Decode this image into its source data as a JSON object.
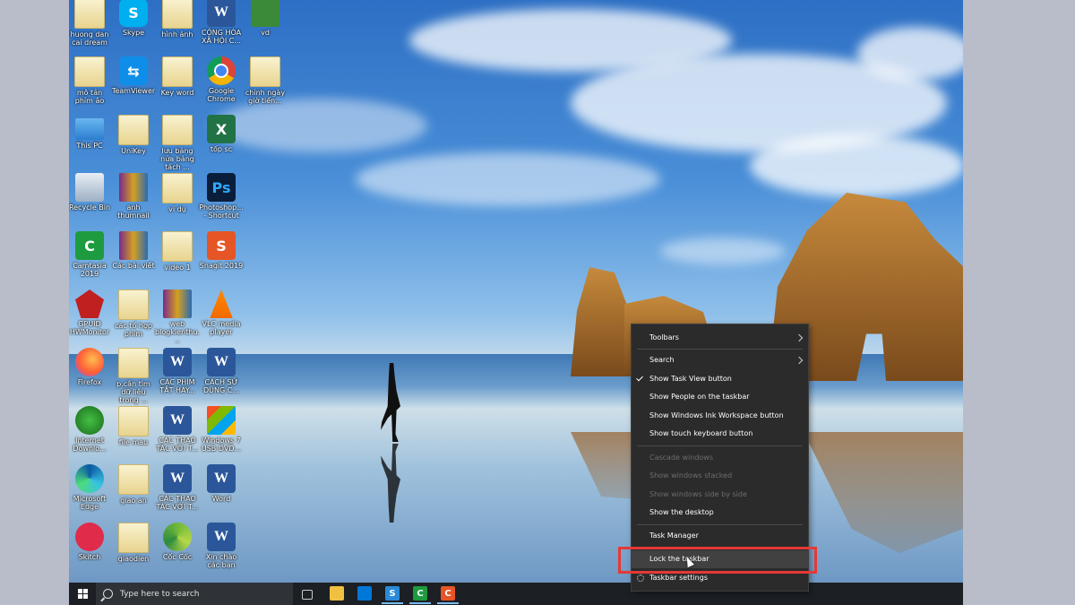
{
  "desktop": {
    "icons": [
      {
        "label": "huong dan cai dream",
        "icon": "folder-icon",
        "x": 0,
        "y": 0
      },
      {
        "label": "Skype",
        "icon": "skype-icon",
        "x": 1,
        "y": 0
      },
      {
        "label": "hình ảnh",
        "icon": "folder-icon",
        "x": 2,
        "y": 0
      },
      {
        "label": "CỘNG HÒA XÃ HỘI C...",
        "icon": "word-icon",
        "x": 3,
        "y": 0
      },
      {
        "label": "vd",
        "icon": "video-file-icon",
        "x": 4,
        "y": 0
      },
      {
        "label": "mô tản phím âo",
        "icon": "folder-icon",
        "x": 0,
        "y": 1
      },
      {
        "label": "TeamViewer",
        "icon": "teamviewer-icon",
        "x": 1,
        "y": 1
      },
      {
        "label": "Key word",
        "icon": "folder-icon",
        "x": 2,
        "y": 1
      },
      {
        "label": "Google Chrome",
        "icon": "chrome-icon",
        "x": 3,
        "y": 1
      },
      {
        "label": "chỉnh ngày giờ tiến...",
        "icon": "folder-icon",
        "x": 4,
        "y": 1
      },
      {
        "label": "This PC",
        "icon": "this-pc-icon",
        "x": 0,
        "y": 2
      },
      {
        "label": "UniKey",
        "icon": "unikey-icon",
        "x": 1,
        "y": 2
      },
      {
        "label": "lưu bảng nửa bảng tách ...",
        "icon": "folder-icon",
        "x": 2,
        "y": 2
      },
      {
        "label": "tốp sc",
        "icon": "excel-icon",
        "x": 3,
        "y": 2
      },
      {
        "label": "Recycle Bin",
        "icon": "recycle-bin-icon",
        "x": 0,
        "y": 3
      },
      {
        "label": "anh thumnail",
        "icon": "image-folder-icon",
        "x": 1,
        "y": 3
      },
      {
        "label": "ví dụ",
        "icon": "folder-icon",
        "x": 2,
        "y": 3
      },
      {
        "label": "Photoshop... - Shortcut",
        "icon": "photoshop-icon",
        "x": 3,
        "y": 3
      },
      {
        "label": "Camtasia 2019",
        "icon": "camtasia-icon",
        "x": 0,
        "y": 4
      },
      {
        "label": "Các bài viết",
        "icon": "winrar-icon",
        "x": 1,
        "y": 4
      },
      {
        "label": "video 1",
        "icon": "folder-icon",
        "x": 2,
        "y": 4
      },
      {
        "label": "Snagit 2019",
        "icon": "snagit-icon",
        "x": 3,
        "y": 4
      },
      {
        "label": "GPUID HWMonitor",
        "icon": "hwmonitor-icon",
        "x": 0,
        "y": 5
      },
      {
        "label": "các tổ hợp phím",
        "icon": "folder-icon",
        "x": 1,
        "y": 5
      },
      {
        "label": "web blogkienthu...",
        "icon": "winrar-icon",
        "x": 2,
        "y": 5
      },
      {
        "label": "VLC media player",
        "icon": "vlc-icon",
        "x": 3,
        "y": 5
      },
      {
        "label": "Firefox",
        "icon": "firefox-icon",
        "x": 0,
        "y": 6
      },
      {
        "label": "p.cân tìm dữ liệu trong ...",
        "icon": "folder-icon",
        "x": 1,
        "y": 6
      },
      {
        "label": "CÁC PHÍM TẮT HAY...",
        "icon": "word-icon",
        "x": 2,
        "y": 6
      },
      {
        "label": "CÁCH SỬ DỤNG C...",
        "icon": "word-icon",
        "x": 3,
        "y": 6
      },
      {
        "label": "Internet Downlo...",
        "icon": "idm-icon",
        "x": 0,
        "y": 7
      },
      {
        "label": "file mau",
        "icon": "archive-icon",
        "x": 1,
        "y": 7
      },
      {
        "label": "CÁC THAO TÁC VỚI T...",
        "icon": "word-icon",
        "x": 2,
        "y": 7
      },
      {
        "label": "Windows 7 USB DVD...",
        "icon": "windows7-icon",
        "x": 3,
        "y": 7
      },
      {
        "label": "Microsoft Edge",
        "icon": "edge-icon",
        "x": 0,
        "y": 8
      },
      {
        "label": "giao an",
        "icon": "folder-icon",
        "x": 1,
        "y": 8
      },
      {
        "label": "CÁC THAO TÁC VỚI T...",
        "icon": "word-icon",
        "x": 2,
        "y": 8
      },
      {
        "label": "Word",
        "icon": "word-app-icon",
        "x": 3,
        "y": 8
      },
      {
        "label": "Skitch",
        "icon": "skitch-icon",
        "x": 0,
        "y": 9
      },
      {
        "label": "giaodien",
        "icon": "folder-icon",
        "x": 1,
        "y": 9
      },
      {
        "label": "Cốc Cốc",
        "icon": "coccoc-icon",
        "x": 2,
        "y": 9
      },
      {
        "label": "Xin chào các bạn",
        "icon": "word-icon",
        "x": 3,
        "y": 9
      }
    ]
  },
  "taskbar": {
    "start_icon": "windows-start-icon",
    "search_placeholder": "Type here to search",
    "apps": [
      "task-view-icon",
      "file-explorer-icon",
      "mail-icon",
      "snagit-icon",
      "camtasia-icon",
      "snagit-editor-icon"
    ]
  },
  "context_menu": {
    "items": [
      {
        "label": "Toolbars",
        "submenu": true
      },
      {
        "label": "Search",
        "submenu": true
      },
      {
        "label": "Show Task View button",
        "checked": true
      },
      {
        "label": "Show People on the taskbar"
      },
      {
        "label": "Show Windows Ink Workspace button"
      },
      {
        "label": "Show touch keyboard button"
      },
      {
        "label": "Cascade windows",
        "disabled": true
      },
      {
        "label": "Show windows stacked",
        "disabled": true
      },
      {
        "label": "Show windows side by side",
        "disabled": true
      },
      {
        "label": "Show the desktop"
      },
      {
        "label": "Task Manager"
      },
      {
        "label": "Lock the taskbar",
        "hover": true
      },
      {
        "label": "Taskbar settings",
        "gear": true
      }
    ]
  },
  "colors": {
    "menu_bg": "#2b2b2b",
    "highlight_border": "#e53935",
    "taskbar_bg": "#1c1f24"
  }
}
